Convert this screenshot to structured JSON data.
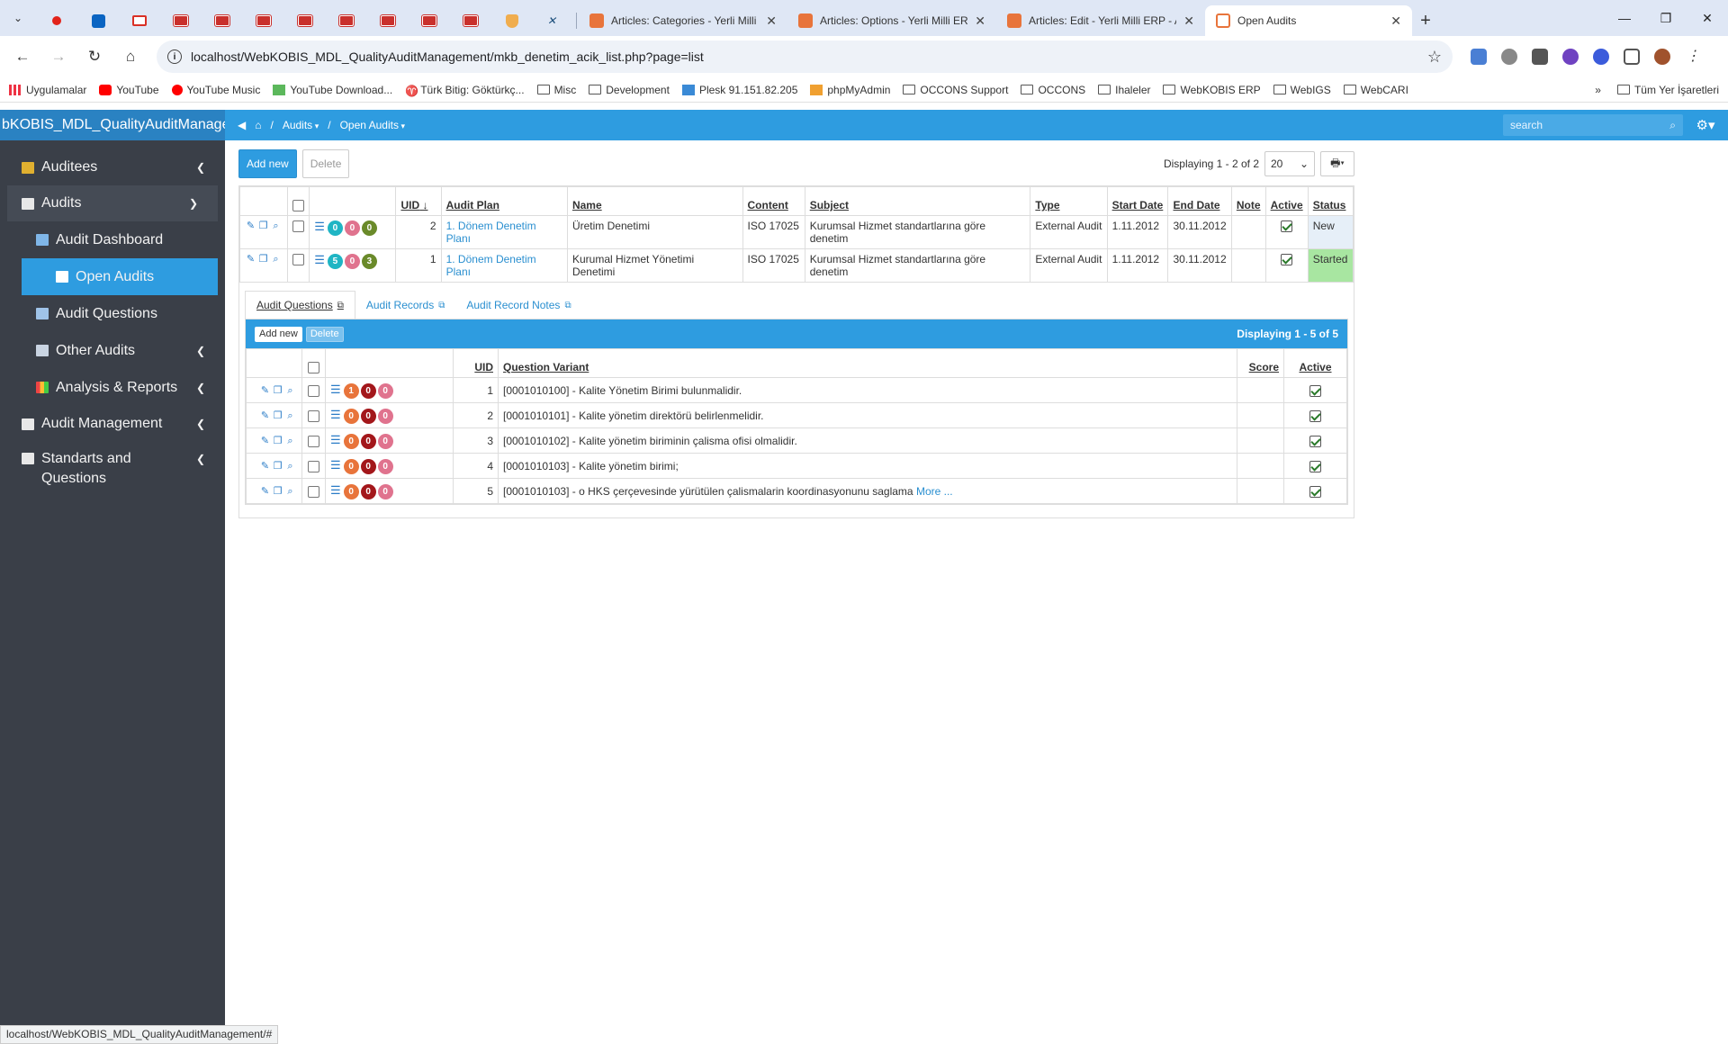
{
  "browser": {
    "tabs": [
      {
        "title": "Articles: Categories - Yerli Milli E",
        "active": false
      },
      {
        "title": "Articles: Options - Yerli Milli ERP",
        "active": false
      },
      {
        "title": "Articles: Edit - Yerli Milli ERP - A",
        "active": false
      },
      {
        "title": "Open Audits",
        "active": true
      }
    ],
    "url": "localhost/WebKOBIS_MDL_QualityAuditManagement/mkb_denetim_acik_list.php?page=list",
    "bookmarks": [
      "Uygulamalar",
      "YouTube",
      "YouTube Music",
      "YouTube Download...",
      "Türk Bitig: Göktürkç...",
      "Misc",
      "Development",
      "Plesk 91.151.82.205",
      "phpMyAdmin",
      "OCCONS Support",
      "OCCONS",
      "Ihaleler",
      "WebKOBIS ERP",
      "WebIGS",
      "WebCARI"
    ],
    "bookmarks_all": "Tüm Yer İşaretleri",
    "status_url": "localhost/WebKOBIS_MDL_QualityAuditManagement/#"
  },
  "app": {
    "brand": "bKOBIS_MDL_QualityAuditManagem",
    "breadcrumb": [
      "Audits",
      "Open Audits"
    ],
    "search_placeholder": "search"
  },
  "sidebar": {
    "items": [
      {
        "label": "Auditees"
      },
      {
        "label": "Audits"
      },
      {
        "label": "Audit Dashboard"
      },
      {
        "label": "Open Audits"
      },
      {
        "label": "Audit Questions"
      },
      {
        "label": "Other Audits"
      },
      {
        "label": "Analysis & Reports"
      },
      {
        "label": "Audit Management"
      },
      {
        "label": "Standarts and Questions"
      }
    ]
  },
  "main": {
    "add_new": "Add new",
    "delete": "Delete",
    "displaying": "Displaying 1 - 2 of 2",
    "page_size": "20",
    "columns": [
      "UID",
      "Audit Plan",
      "Name",
      "Content",
      "Subject",
      "Type",
      "Start Date",
      "End Date",
      "Note",
      "Active",
      "Status"
    ],
    "rows": [
      {
        "counts": [
          "0",
          "0",
          "0"
        ],
        "uid": "2",
        "plan": "1. Dönem Denetim Planı",
        "name": "Üretim Denetimi",
        "content": "ISO 17025",
        "subject": "Kurumsal Hizmet standartlarına göre denetim",
        "type": "External Audit",
        "start": "1.11.2012",
        "end": "30.11.2012",
        "note": "",
        "status": "New"
      },
      {
        "counts": [
          "5",
          "0",
          "3"
        ],
        "uid": "1",
        "plan": "1. Dönem Denetim Planı",
        "name": "Kurumal Hizmet Yönetimi Denetimi",
        "content": "ISO 17025",
        "subject": "Kurumsal Hizmet standartlarına göre denetim",
        "type": "External Audit",
        "start": "1.11.2012",
        "end": "30.11.2012",
        "note": "",
        "status": "Started"
      }
    ]
  },
  "details": {
    "tabs": [
      "Audit Questions",
      "Audit Records",
      "Audit Record Notes"
    ],
    "add_new": "Add new",
    "delete": "Delete",
    "displaying": "Displaying 1 - 5 of 5",
    "columns": [
      "UID",
      "Question Variant",
      "Score",
      "Active"
    ],
    "more": "More ...",
    "rows": [
      {
        "counts": [
          "1",
          "0",
          "0"
        ],
        "uid": "1",
        "question": "[0001010100] - Kalite Yönetim Birimi bulunmalidir."
      },
      {
        "counts": [
          "0",
          "0",
          "0"
        ],
        "uid": "2",
        "question": "[0001010101] - Kalite yönetim direktörü belirlenmelidir."
      },
      {
        "counts": [
          "0",
          "0",
          "0"
        ],
        "uid": "3",
        "question": "[0001010102] - Kalite yönetim biriminin çalisma ofisi olmalidir."
      },
      {
        "counts": [
          "0",
          "0",
          "0"
        ],
        "uid": "4",
        "question": "[0001010103] - Kalite yönetim birimi;"
      },
      {
        "counts": [
          "0",
          "0",
          "0"
        ],
        "uid": "5",
        "question": "[0001010103] - o HKS çerçevesinde yürütülen çalismalarin koordinasyonunu saglama"
      }
    ]
  },
  "colors": {
    "accent": "#2e9ce0",
    "sidebar": "#3a3f48",
    "started": "#a8e6a1",
    "pill_teal": "#1fb5c4",
    "pill_pink": "#e0738e",
    "pill_olive": "#6a8a2a",
    "pill_orange": "#e8743b",
    "pill_darkred": "#a3171b"
  }
}
